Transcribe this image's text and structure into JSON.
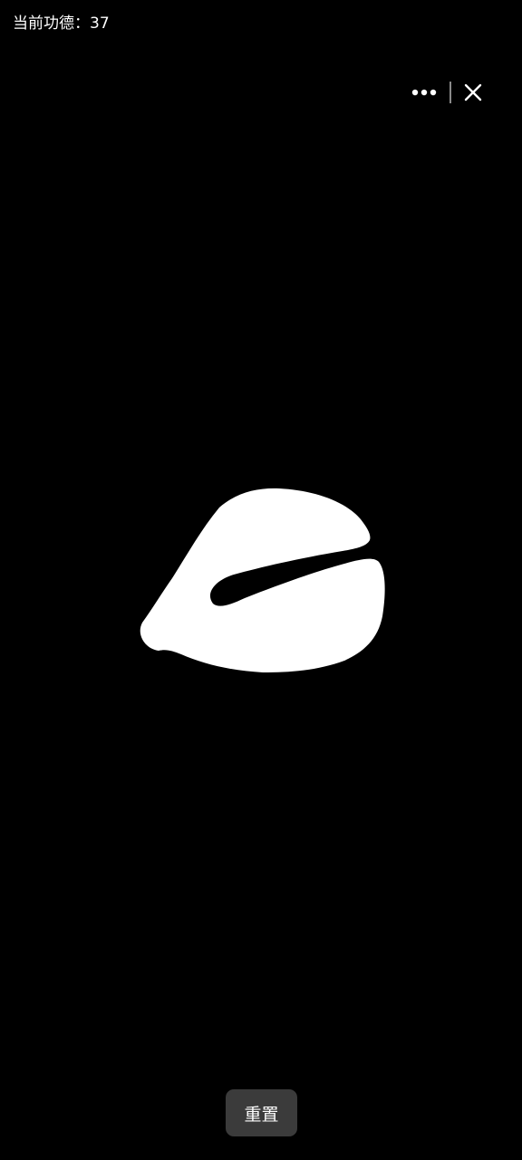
{
  "header": {
    "merit_label": "当前功德",
    "merit_separator": "：",
    "merit_value": "37"
  },
  "capsule": {
    "more_icon": "more-dots-icon",
    "close_icon": "close-icon"
  },
  "main": {
    "object_icon": "wooden-fish-icon"
  },
  "footer": {
    "reset_label": "重置"
  },
  "colors": {
    "background": "#000000",
    "foreground": "#ffffff",
    "button_bg": "#3b3b3b"
  }
}
